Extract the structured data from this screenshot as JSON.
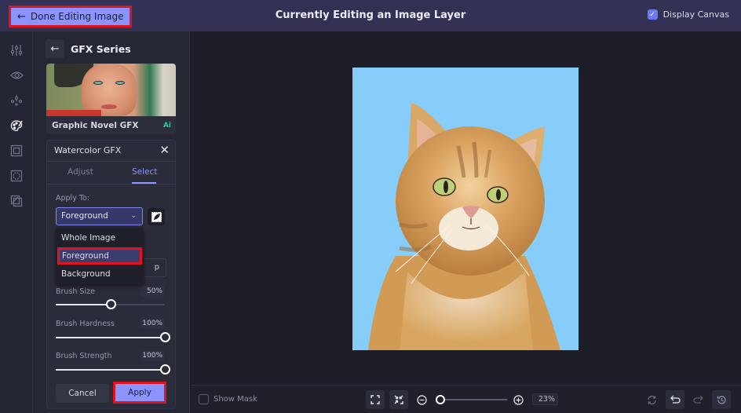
{
  "topbar": {
    "done_label": "Done Editing Image",
    "title": "Currently Editing an Image Layer",
    "display_canvas_label": "Display Canvas",
    "display_canvas_checked": true
  },
  "iconbar": {
    "items": [
      {
        "icon": "sliders-icon",
        "active": false
      },
      {
        "icon": "eye-icon",
        "active": false
      },
      {
        "icon": "sparkles-icon",
        "active": false
      },
      {
        "icon": "palette-icon",
        "active": true
      },
      {
        "icon": "frame-icon",
        "active": false
      },
      {
        "icon": "border-icon",
        "active": false
      },
      {
        "icon": "layers-icon",
        "active": false
      }
    ]
  },
  "panel": {
    "series_title": "GFX Series",
    "card": {
      "label": "Graphic Novel GFX",
      "badge": "Ai"
    },
    "effect": {
      "title": "Watercolor GFX",
      "tabs": [
        {
          "label": "Adjust",
          "active": false
        },
        {
          "label": "Select",
          "active": true
        }
      ],
      "apply_to_label": "Apply To:",
      "apply_to_value": "Foreground",
      "dropdown_options": [
        "Whole Image",
        "Foreground",
        "Background"
      ],
      "dropdown_selected": "Foreground",
      "hidden_button_fragment": "p",
      "sliders": [
        {
          "label": "Brush Size",
          "value_label": "50%",
          "value": 50
        },
        {
          "label": "Brush Hardness",
          "value_label": "100%",
          "value": 100
        },
        {
          "label": "Brush Strength",
          "value_label": "100%",
          "value": 100
        }
      ],
      "cancel_label": "Cancel",
      "apply_label": "Apply"
    }
  },
  "bottombar": {
    "show_mask_label": "Show Mask",
    "show_mask_checked": false,
    "zoom_label": "23%",
    "zoom_value": 23
  },
  "colors": {
    "accent": "#8b93ff",
    "highlight_outline": "#e0141e",
    "canvas_bg": "#86cdf9",
    "ai_badge": "#2fc6a6"
  }
}
